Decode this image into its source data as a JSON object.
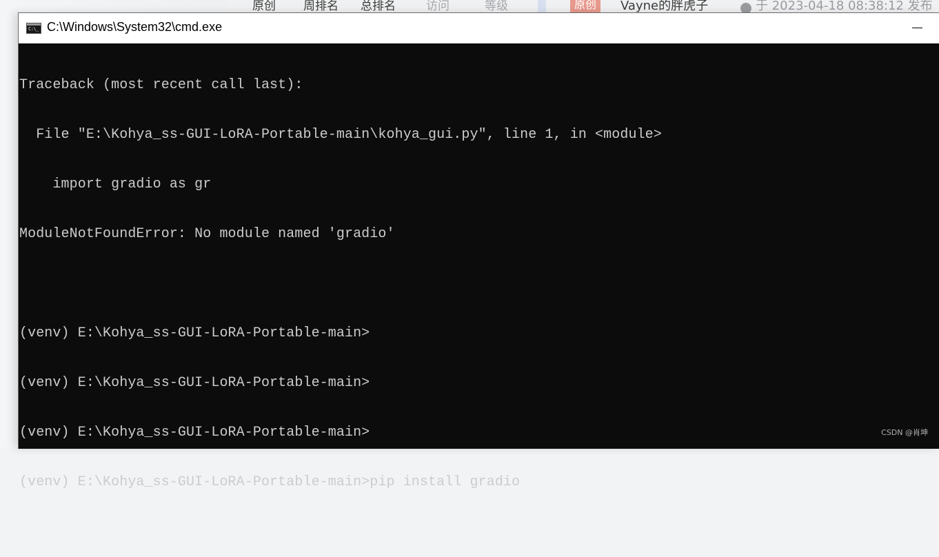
{
  "background_page": {
    "stats": [
      "原创",
      "周排名",
      "总排名",
      "访问",
      "等级"
    ],
    "badge": "原创",
    "author": "Vayne的胖虎子",
    "published": "于 2023-04-18 08:38:12 发布"
  },
  "window": {
    "title": "C:\\Windows\\System32\\cmd.exe",
    "icon": "cmd-icon",
    "icon_text": "C:\\_",
    "minimize_label": "—"
  },
  "console": {
    "lines": [
      "Traceback (most recent call last):",
      "  File \"E:\\Kohya_ss-GUI-LoRA-Portable-main\\kohya_gui.py\", line 1, in <module>",
      "    import gradio as gr",
      "ModuleNotFoundError: No module named 'gradio'",
      "",
      "(venv) E:\\Kohya_ss-GUI-LoRA-Portable-main>",
      "(venv) E:\\Kohya_ss-GUI-LoRA-Portable-main>",
      "(venv) E:\\Kohya_ss-GUI-LoRA-Portable-main>"
    ],
    "prompt": "(venv) E:\\Kohya_ss-GUI-LoRA-Portable-main>",
    "current_input": "pip install gradio"
  },
  "watermark": "CSDN @肖坤",
  "colors": {
    "console_bg": "#0c0c0c",
    "console_fg": "#cccccc",
    "titlebar_bg": "#ffffff"
  }
}
